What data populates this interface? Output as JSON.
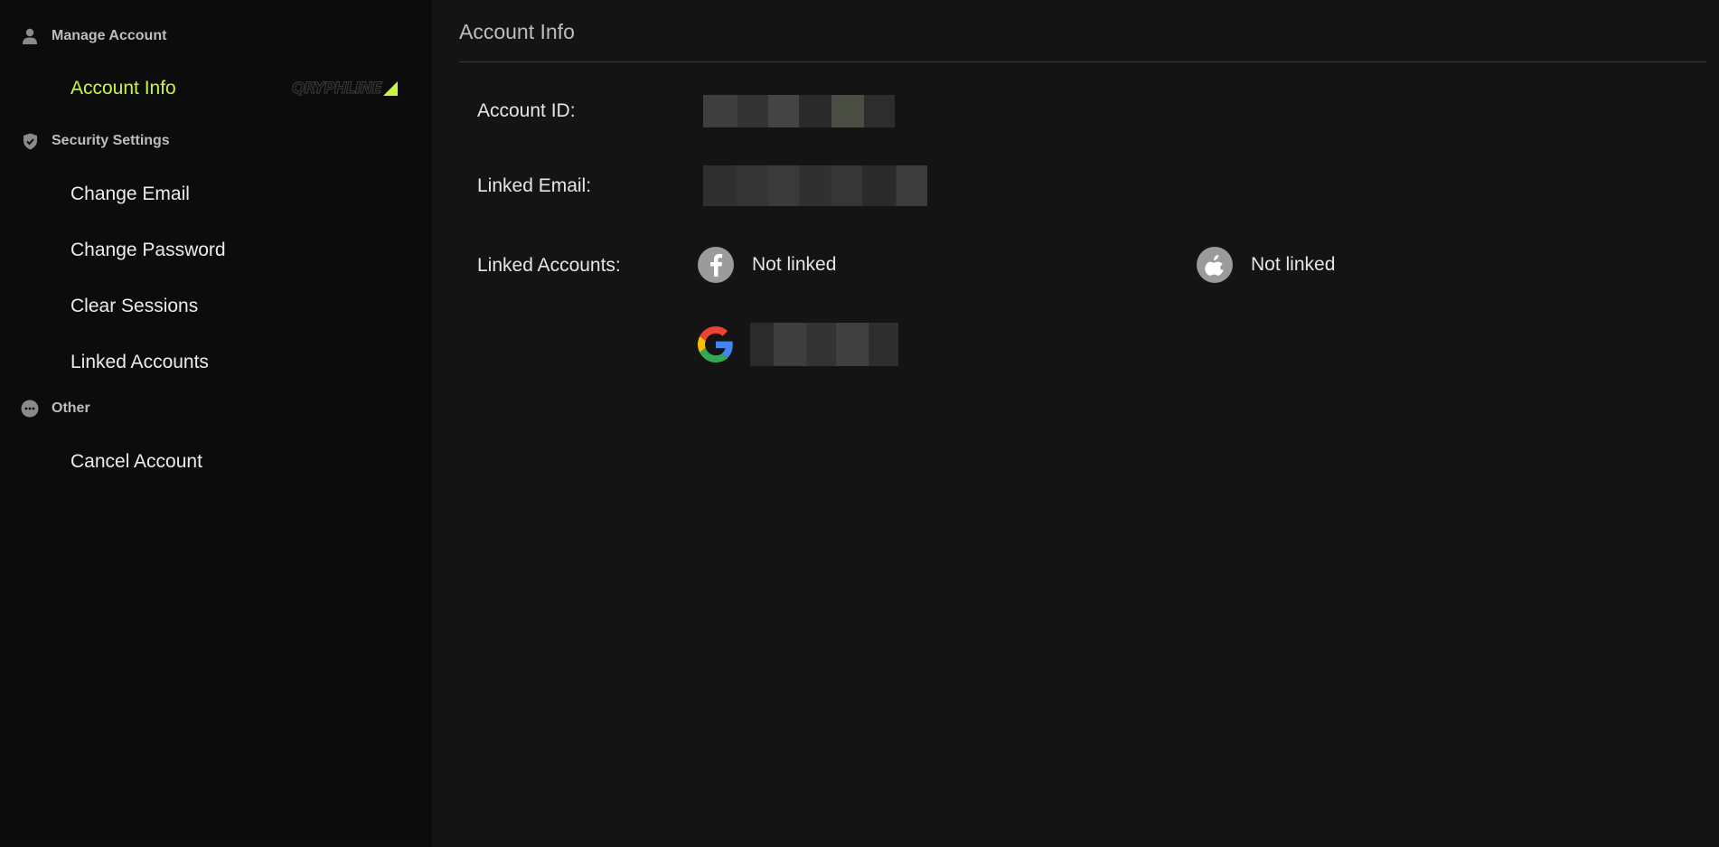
{
  "sidebar": {
    "groups": [
      {
        "header": "Manage Account",
        "icon": "user-icon",
        "items": [
          {
            "label": "Account Info",
            "active": true
          }
        ]
      },
      {
        "header": "Security Settings",
        "icon": "shield-check-icon",
        "items": [
          {
            "label": "Change Email"
          },
          {
            "label": "Change Password"
          },
          {
            "label": "Clear Sessions"
          },
          {
            "label": "Linked Accounts"
          }
        ]
      },
      {
        "header": "Other",
        "icon": "more-dots-icon",
        "items": [
          {
            "label": "Cancel Account"
          }
        ]
      }
    ],
    "brand_text": "QRYPHLINE",
    "accent_color": "#c8f545"
  },
  "main": {
    "title": "Account Info",
    "account_id_label": "Account ID:",
    "linked_email_label": "Linked Email:",
    "linked_accounts_label": "Linked Accounts:",
    "linked_accounts": {
      "facebook": {
        "icon": "facebook-icon",
        "status": "Not linked"
      },
      "apple": {
        "icon": "apple-icon",
        "status": "Not linked"
      },
      "google": {
        "icon": "google-icon"
      }
    }
  }
}
